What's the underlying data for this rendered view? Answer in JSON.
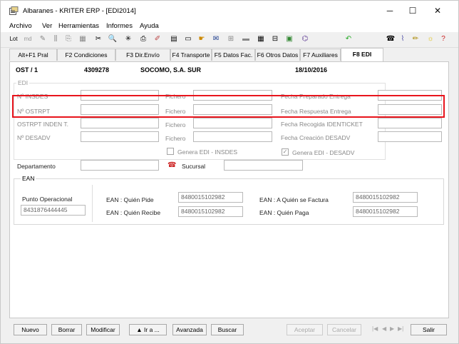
{
  "window": {
    "title": "Albaranes - KRITER ERP -  [EDI2014]"
  },
  "menu": [
    "Archivo",
    "Ver",
    "Herramientas",
    "Informes",
    "Ayuda"
  ],
  "toolbar": {
    "lot_label": "Lot",
    "md_label": "md"
  },
  "tabs": [
    "Alt+F1 Pral",
    "F2 Condiciones",
    "F3 Dir.Envío",
    "F4 Transporte",
    "F5 Datos Fac.",
    "F6 Otros Datos",
    "F7 Auxiliares",
    "F8 EDI"
  ],
  "record": {
    "code": "OST / 1",
    "number": "4309278",
    "company": "SOCOMO, S.A. SUR",
    "date": "18/10/2016"
  },
  "edi": {
    "group_title": "EDI",
    "rows": [
      {
        "label": "Nº INSDES",
        "fichero": "Fichero",
        "fecha_label": "Fecha Preparado Entrega"
      },
      {
        "label": "Nº OSTRPT",
        "fichero": "Fichero",
        "fecha_label": "Fecha Respuesta Entrega"
      },
      {
        "label": "OSTRPT INDEN T.",
        "fichero": "Fichero",
        "fecha_label": "Fecha Recogida IDENTICKET"
      },
      {
        "label": "Nº DESADV",
        "fichero": "Fichero",
        "fecha_label": "Fecha Creación DESADV"
      }
    ],
    "genera_insdes": "Genera EDI - INSDES",
    "genera_desadv": "Genera EDI - DESADV",
    "genera_desadv_check": "✓"
  },
  "departamento": {
    "label": "Departamento",
    "value": ""
  },
  "sucursal": {
    "label": "Sucursal",
    "value": ""
  },
  "ean": {
    "group_title": "EAN",
    "punto_label": "Punto Operacional",
    "punto_value": "8431876444445",
    "quien_pide_label": "EAN : Quién Pide",
    "quien_pide_value": "8480015102982",
    "quien_recibe_label": "EAN : Quién Recibe",
    "quien_recibe_value": "8480015102982",
    "factura_label": "EAN : A Quién se Factura",
    "factura_value": "8480015102982",
    "paga_label": "EAN : Quién Paga",
    "paga_value": "8480015102982"
  },
  "buttons": {
    "nuevo": "Nuevo",
    "borrar": "Borrar",
    "modificar": "Modificar",
    "ira": "▲ Ir a ...",
    "avanzada": "Avanzada",
    "buscar": "Buscar",
    "aceptar": "Aceptar",
    "cancelar": "Cancelar",
    "salir": "Salir"
  },
  "nav": {
    "first": "|◀",
    "prev": "◀",
    "next": "▶",
    "last": "▶|"
  }
}
